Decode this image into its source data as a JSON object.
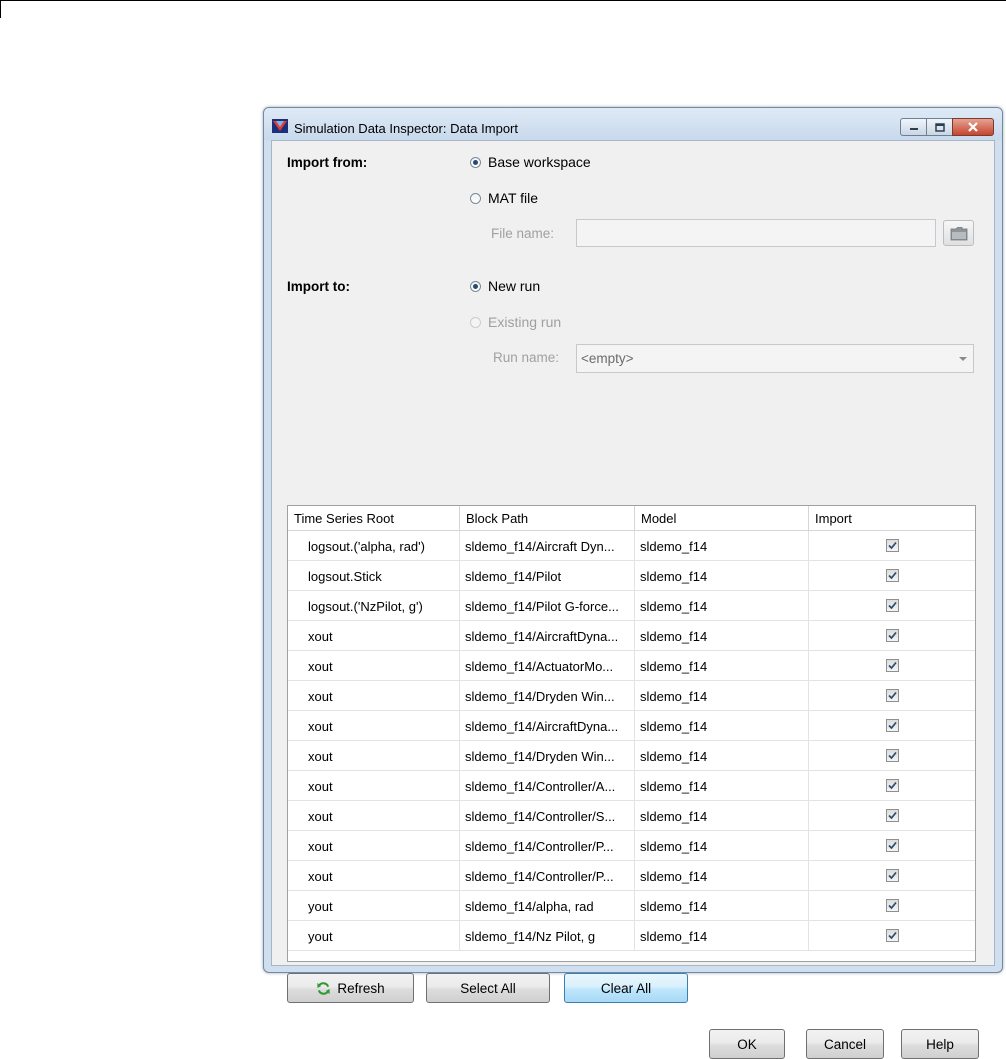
{
  "window": {
    "title": "Simulation Data Inspector: Data Import"
  },
  "import_from": {
    "label": "Import from:",
    "options": [
      "Base workspace",
      "MAT file"
    ],
    "selected": "Base workspace",
    "file_name_label": "File name:",
    "file_name_value": ""
  },
  "import_to": {
    "label": "Import to:",
    "options": [
      "New run",
      "Existing run"
    ],
    "selected": "New run",
    "run_name_label": "Run name:",
    "run_name_value": "<empty>"
  },
  "table": {
    "columns": [
      "Time Series Root",
      "Block Path",
      "Model",
      "Import"
    ],
    "rows": [
      {
        "root": "logsout.('alpha, rad')",
        "path": "sldemo_f14/Aircraft Dyn...",
        "model": "sldemo_f14",
        "import": true
      },
      {
        "root": "logsout.Stick",
        "path": "sldemo_f14/Pilot",
        "model": "sldemo_f14",
        "import": true
      },
      {
        "root": "logsout.('NzPilot, g')",
        "path": "sldemo_f14/Pilot G-force...",
        "model": "sldemo_f14",
        "import": true
      },
      {
        "root": "xout",
        "path": "sldemo_f14/AircraftDyna...",
        "model": "sldemo_f14",
        "import": true
      },
      {
        "root": "xout",
        "path": "sldemo_f14/ActuatorMo...",
        "model": "sldemo_f14",
        "import": true
      },
      {
        "root": "xout",
        "path": "sldemo_f14/Dryden Win...",
        "model": "sldemo_f14",
        "import": true
      },
      {
        "root": "xout",
        "path": "sldemo_f14/AircraftDyna...",
        "model": "sldemo_f14",
        "import": true
      },
      {
        "root": "xout",
        "path": "sldemo_f14/Dryden Win...",
        "model": "sldemo_f14",
        "import": true
      },
      {
        "root": "xout",
        "path": "sldemo_f14/Controller/A...",
        "model": "sldemo_f14",
        "import": true
      },
      {
        "root": "xout",
        "path": "sldemo_f14/Controller/S...",
        "model": "sldemo_f14",
        "import": true
      },
      {
        "root": "xout",
        "path": "sldemo_f14/Controller/P...",
        "model": "sldemo_f14",
        "import": true
      },
      {
        "root": "xout",
        "path": "sldemo_f14/Controller/P...",
        "model": "sldemo_f14",
        "import": true
      },
      {
        "root": "yout",
        "path": "sldemo_f14/alpha, rad",
        "model": "sldemo_f14",
        "import": true
      },
      {
        "root": "yout",
        "path": "sldemo_f14/Nz Pilot, g",
        "model": "sldemo_f14",
        "import": true
      }
    ]
  },
  "buttons": {
    "refresh": "Refresh",
    "select_all": "Select All",
    "clear_all": "Clear All",
    "ok": "OK",
    "cancel": "Cancel",
    "help": "Help"
  },
  "icons": {
    "app": "simulink-icon",
    "folder": "folder-icon",
    "refresh": "refresh-icon"
  },
  "colors": {
    "focus_button": "#bee6fd",
    "close_button": "#c5462e",
    "refresh_green": "#2f9a2f"
  }
}
